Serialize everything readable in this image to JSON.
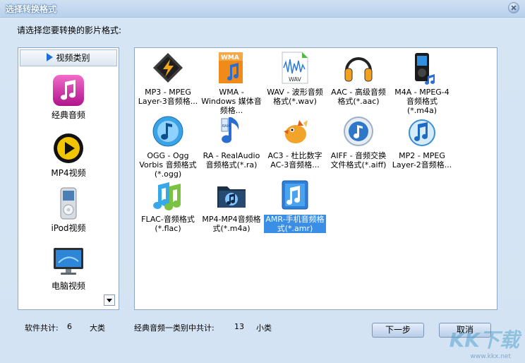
{
  "window": {
    "title": "选择转换格式",
    "close_icon": "close-icon"
  },
  "prompt": "请选择您要转换的影片格式:",
  "sidebar": {
    "header": "视频类别",
    "items": [
      {
        "label": "经典音频",
        "icon": "music-note-icon"
      },
      {
        "label": "MP4视频",
        "icon": "play-circle-icon"
      },
      {
        "label": "iPod视频",
        "icon": "ipod-icon"
      },
      {
        "label": "电脑视频",
        "icon": "monitor-icon"
      }
    ]
  },
  "formats": [
    {
      "label": "MP3 - MPEG Layer-3音频格...",
      "icon": "mp3-winamp-icon"
    },
    {
      "label": "WMA - Windows 媒体音频格...",
      "icon": "wma-icon"
    },
    {
      "label": "WAV - 波形音频格式(*.wav)",
      "icon": "wav-icon"
    },
    {
      "label": "AAC - 高级音频格式(*.aac)",
      "icon": "headphones-icon"
    },
    {
      "label": "M4A - MPEG-4音频格式(*.m4a)",
      "icon": "m4a-player-icon"
    },
    {
      "label": "OGG - Ogg Vorbis 音频格式(*.ogg)",
      "icon": "ogg-icon"
    },
    {
      "label": "RA - RealAudio音频格式(*.ra)",
      "icon": "ram-note-icon"
    },
    {
      "label": "AC3 - 杜比数字 AC-3音频格...",
      "icon": "bird-icon"
    },
    {
      "label": "AIFF - 音频交换文件格式(*.aiff)",
      "icon": "aiff-icon"
    },
    {
      "label": "MP2 - MPEG Layer-2音频格...",
      "icon": "mp2-notes-icon"
    },
    {
      "label": "FLAC-音频格式(*.flac)",
      "icon": "flac-notes-icon"
    },
    {
      "label": "MP4-MP4音频格式(*.m4a)",
      "icon": "folder-music-icon"
    },
    {
      "label": "AMR-手机音频格式(*.amr)",
      "icon": "amr-icon",
      "selected": true
    }
  ],
  "status": {
    "software_total_label": "软件共计:",
    "software_total_value": "6",
    "software_total_unit": "大类",
    "category_total_label": "经典音频一类别中共计:",
    "category_total_value": "13",
    "category_total_unit": "小类"
  },
  "buttons": {
    "next": "下一步",
    "cancel": "取消"
  },
  "watermark": {
    "text": "KK下载",
    "url": "www.kkx.net"
  }
}
